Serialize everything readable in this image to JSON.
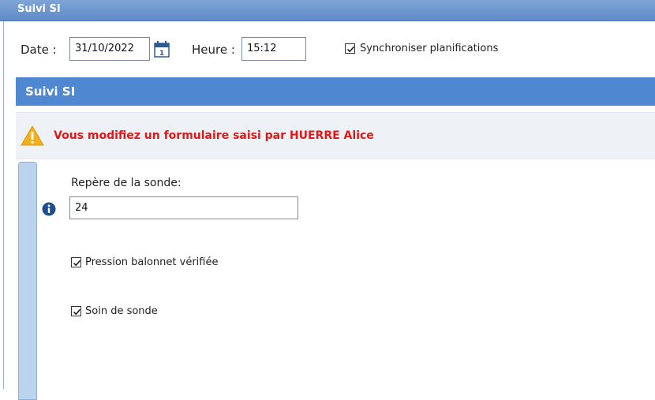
{
  "window": {
    "title": "Suivi SI"
  },
  "toolbar": {
    "date_label": "Date :",
    "date_value": "31/10/2022",
    "time_label": "Heure :",
    "time_value": "15:12",
    "sync_label": "Synchroniser planifications",
    "sync_checked": true
  },
  "section": {
    "title": "Suivi SI"
  },
  "warning": {
    "text": "Vous modifiez un formulaire saisi par HUERRE Alice"
  },
  "form": {
    "repere_label": "Repère de la sonde:",
    "repere_value": "24",
    "pression_label": "Pression balonnet vérifiée",
    "pression_checked": true,
    "soin_label": "Soin de sonde",
    "soin_checked": true
  },
  "colors": {
    "titlebar": "#6a95cf",
    "section": "#4f88d0",
    "warning_text": "#e01818",
    "warning_icon": "#f2b01e",
    "info_icon": "#1f4e8c"
  },
  "icons": [
    "calendar-icon",
    "warning-icon",
    "info-icon",
    "checkbox-checked-icon"
  ]
}
